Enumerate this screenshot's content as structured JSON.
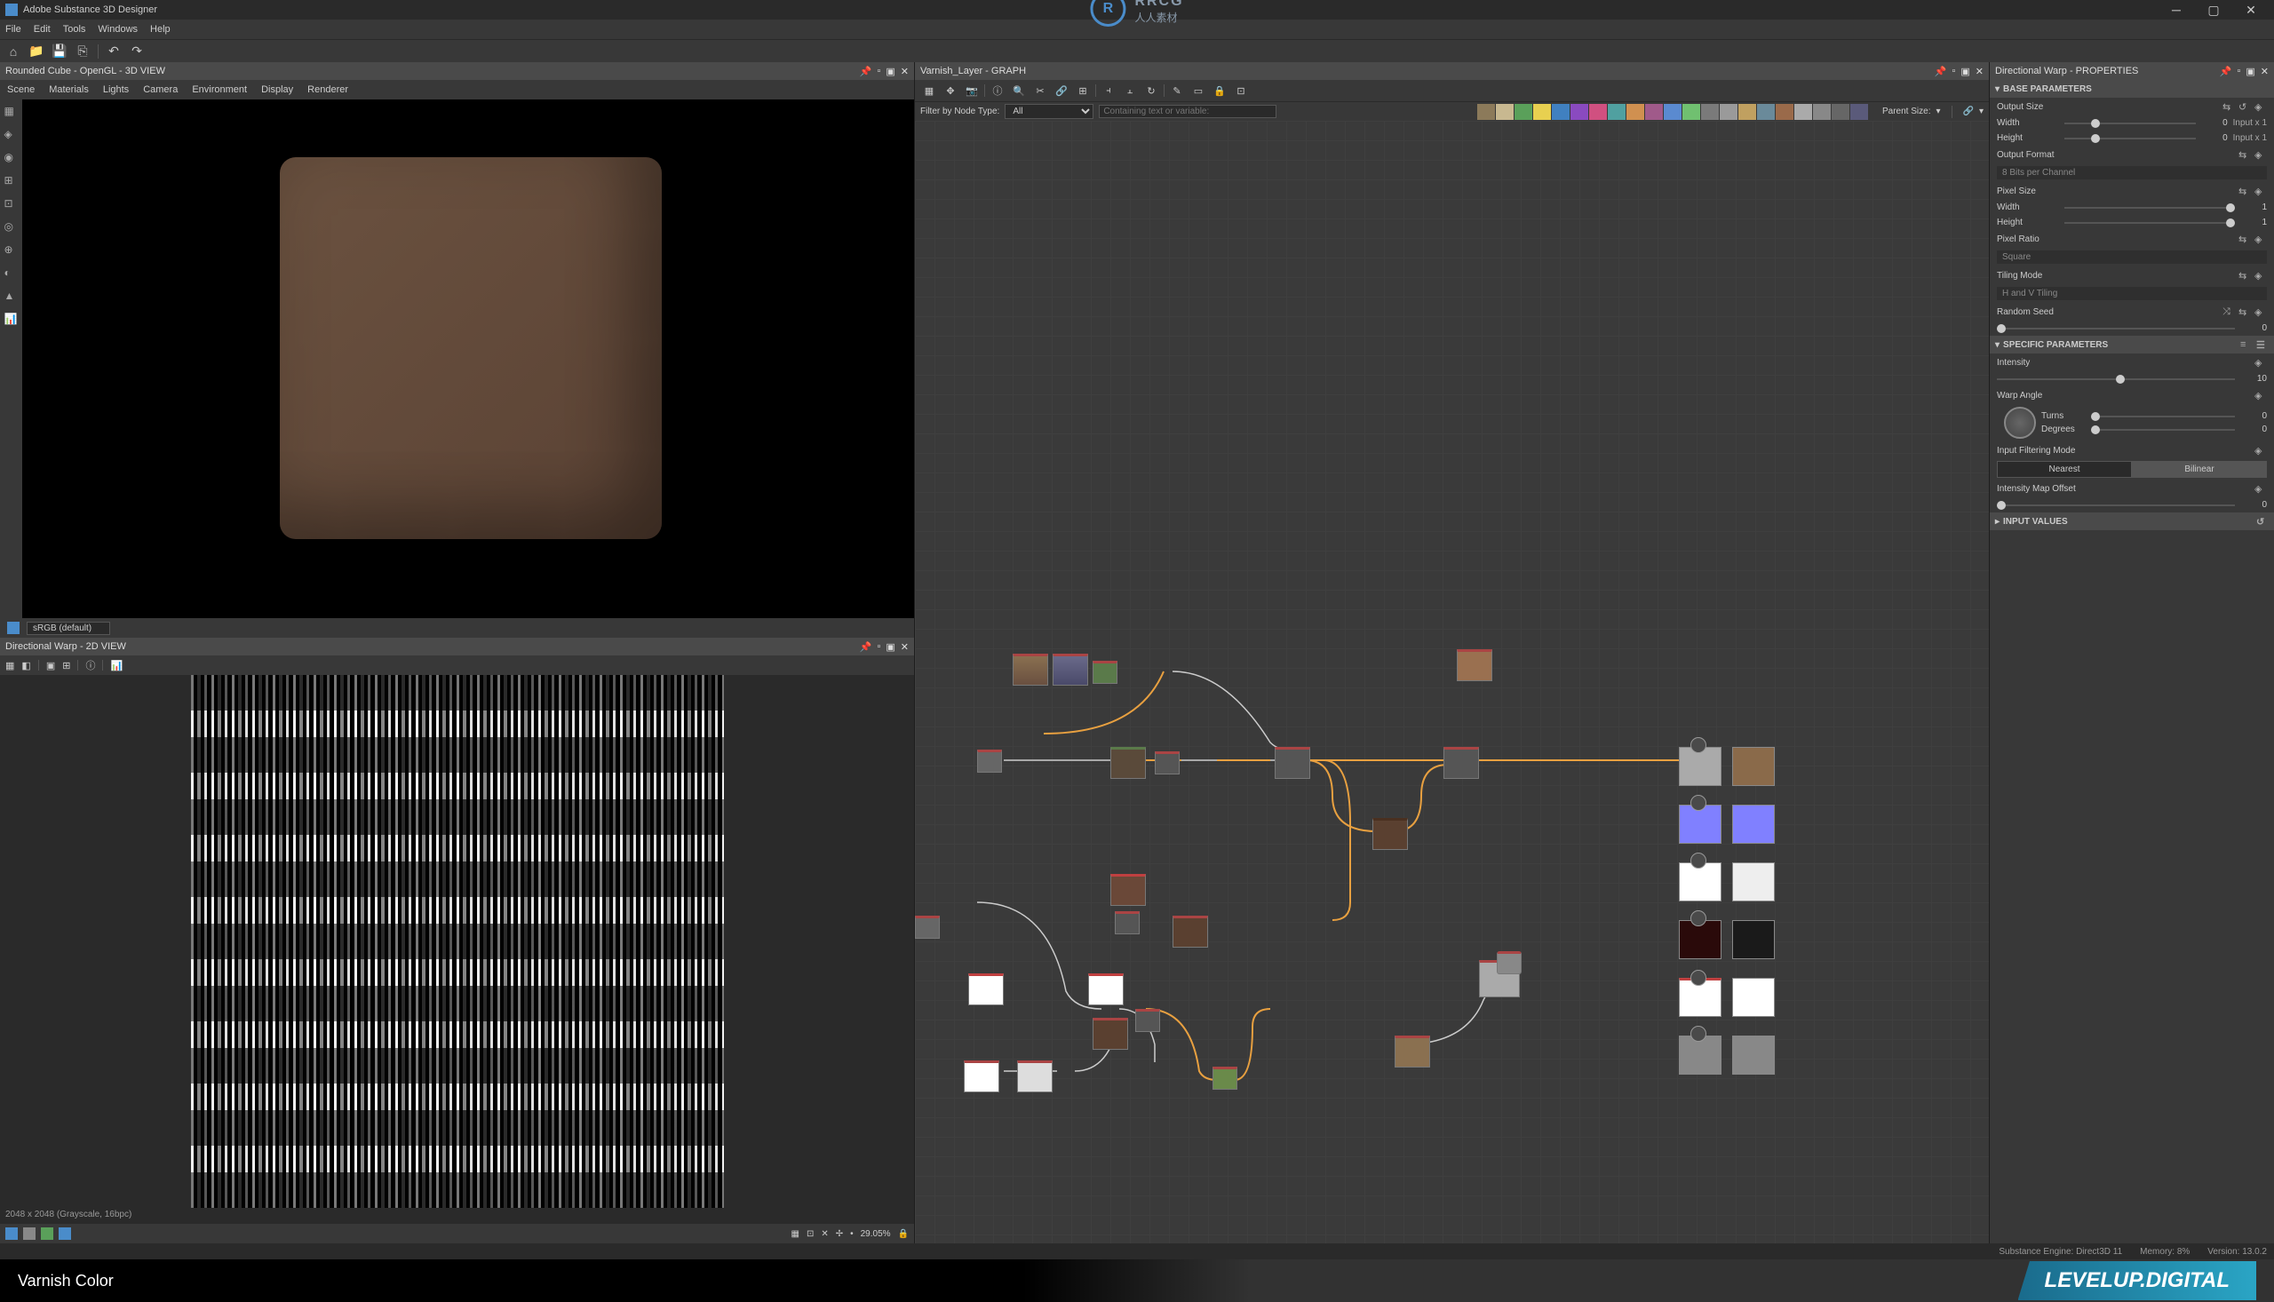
{
  "titlebar": {
    "app_name": "Adobe Substance 3D Designer"
  },
  "menubar": {
    "items": [
      "File",
      "Edit",
      "Tools",
      "Windows",
      "Help"
    ]
  },
  "panel_3d": {
    "title": "Rounded Cube - OpenGL - 3D VIEW",
    "tabs": [
      "Scene",
      "Materials",
      "Lights",
      "Camera",
      "Environment",
      "Display",
      "Renderer"
    ],
    "colorspace": "sRGB (default)"
  },
  "panel_2d": {
    "title": "Directional Warp - 2D VIEW",
    "status": "2048 x 2048 (Grayscale, 16bpc)",
    "zoom": "29.05%"
  },
  "panel_graph": {
    "title": "Varnish_Layer - GRAPH",
    "filter_label": "Filter by Node Type:",
    "filter_type": "All",
    "search_placeholder": "Containing text or variable:",
    "parent_label": "Parent Size:"
  },
  "panel_props": {
    "title": "Directional Warp - PROPERTIES",
    "sections": {
      "base": "BASE PARAMETERS",
      "specific": "SPECIFIC PARAMETERS",
      "input": "INPUT VALUES"
    },
    "output_size": {
      "label": "Output Size",
      "width_label": "Width",
      "width_val": "0",
      "width_link": "Input x 1",
      "height_label": "Height",
      "height_val": "0",
      "height_link": "Input x 1"
    },
    "output_format": {
      "label": "Output Format",
      "value": "8 Bits per Channel"
    },
    "pixel_size": {
      "label": "Pixel Size",
      "width_label": "Width",
      "width_val": "1",
      "height_label": "Height",
      "height_val": "1"
    },
    "pixel_ratio": {
      "label": "Pixel Ratio",
      "value": "Square"
    },
    "tiling_mode": {
      "label": "Tiling Mode",
      "value": "H and V Tiling"
    },
    "random_seed": {
      "label": "Random Seed",
      "value": "0"
    },
    "intensity": {
      "label": "Intensity",
      "value": "10"
    },
    "warp_angle": {
      "label": "Warp Angle",
      "turns_label": "Turns",
      "turns_val": "0",
      "degrees_label": "Degrees",
      "degrees_val": "0"
    },
    "filtering": {
      "label": "Input Filtering Mode",
      "nearest": "Nearest",
      "bilinear": "Bilinear"
    },
    "offset": {
      "label": "Intensity Map Offset",
      "value": "0"
    }
  },
  "statusbar": {
    "engine": "Substance Engine: Direct3D 11",
    "memory": "Memory: 8%",
    "version": "Version: 13.0.2"
  },
  "branding": {
    "left_text": "Varnish Color",
    "right_text": "LEVELUP.DIGITAL",
    "watermark_logo": "R",
    "watermark_text_top": "RRCG",
    "watermark_text_bottom": "人人素材"
  },
  "swatch_colors": [
    "#8c7a5a",
    "#c8b890",
    "#5aa05a",
    "#e8d050",
    "#4080c0",
    "#8a4ac0",
    "#d05080",
    "#50a0a0",
    "#d09050",
    "#a05a8a",
    "#5a8ad0",
    "#70c070",
    "#7a7a7a",
    "#9a9a9a",
    "#c0a060",
    "#6a8a9a",
    "#9a6a4a",
    "#aaaaaa",
    "#888888",
    "#666666",
    "#5a5a7a"
  ]
}
